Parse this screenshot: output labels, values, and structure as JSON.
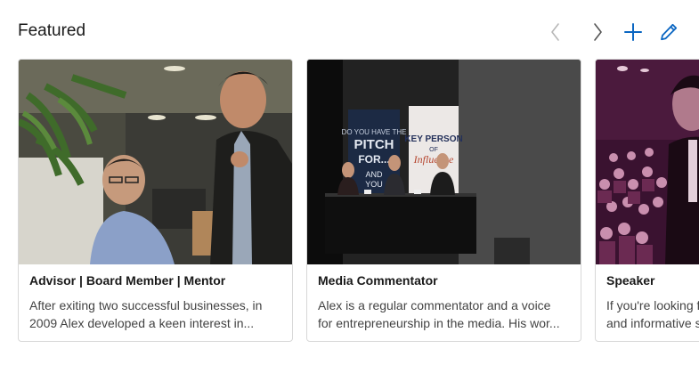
{
  "section": {
    "title": "Featured",
    "controls": {
      "prev": "chevron-left-icon",
      "next": "chevron-right-icon",
      "add": "plus-icon",
      "edit": "pencil-icon"
    }
  },
  "colors": {
    "accent": "#0a66c2",
    "disabled_chevron": "#b7b7b7",
    "enabled_chevron": "#555555",
    "border": "#d8d8d8"
  },
  "cards": [
    {
      "title": "Advisor | Board Member | Mentor",
      "desc_line1": "After exiting two successful businesses, in",
      "desc_line2": "2009 Alex developed a keen interest in..."
    },
    {
      "title": "Media Commentator",
      "desc_line1": "Alex is a regular commentator and a voice",
      "desc_line2": "for entrepreneurship in the media. His wor...",
      "banner_left": "DO YOU HAVE THE PITCH FOR... AND YOU",
      "banner_right": "KEY PERSON OF Influence"
    },
    {
      "title": "Speaker",
      "desc_line1": "If you're looking for a",
      "desc_line2": "and informative spe"
    }
  ]
}
